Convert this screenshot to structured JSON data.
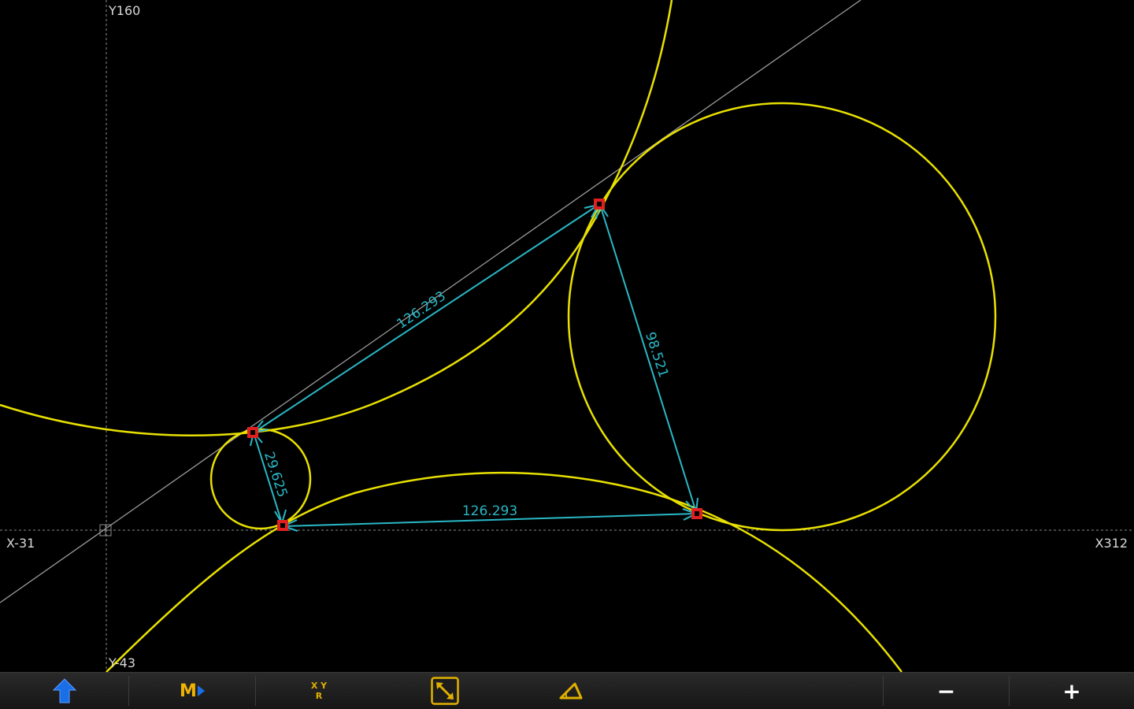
{
  "axes": {
    "y_top_label": "Y160",
    "y_bottom_label": "Y-43",
    "x_left_label": "X-31",
    "x_right_label": "X312"
  },
  "dimensions": {
    "top_line": "126.293",
    "bottom_line": "126.293",
    "right_line": "98.521",
    "left_line": "29.625"
  },
  "toolbar": {
    "m_label": "M",
    "xyr_top": "X Y",
    "xyr_bottom": "R",
    "minus_label": "−",
    "plus_label": "+"
  },
  "colors": {
    "background": "#000000",
    "curves": "#e8e000",
    "dimensions": "#29b8c6",
    "points": "#e02020",
    "grid": "#8a8a8a",
    "toolbar_accent": "#f0b400",
    "shift_arrow": "#1a6fe8"
  },
  "icons": {
    "shift": "up-arrow-icon",
    "mode": "m-play-icon",
    "coords": "xyr-icon",
    "fit": "fit-diagonal-icon",
    "angle": "triangle-angle-icon",
    "zoom_out": "minus-icon",
    "zoom_in": "plus-icon"
  }
}
